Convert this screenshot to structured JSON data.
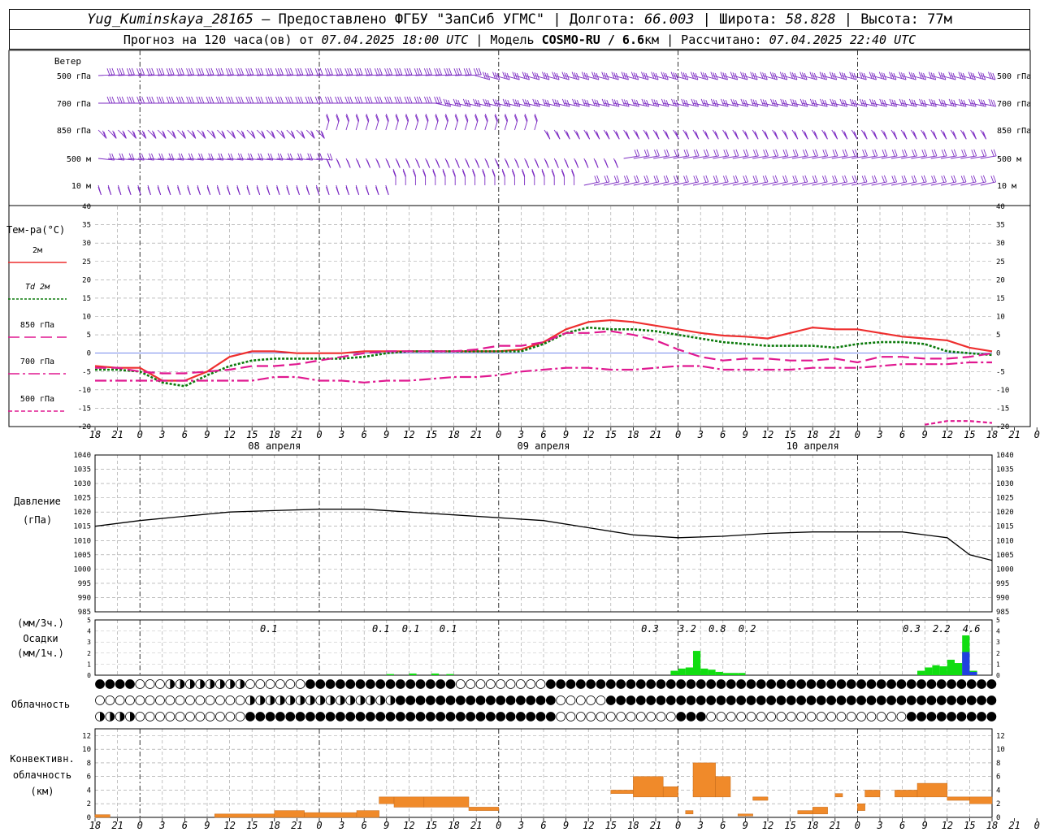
{
  "header": {
    "station": "Yug_Kuminskaya_28165",
    "dash": "—",
    "provider": "Предоставлено ФГБУ \"ЗапСиб УГМС\"",
    "lon_label": "Долгота:",
    "lon_value": "66.003",
    "lat_label": "Широта:",
    "lat_value": "58.828",
    "alt_label": "Высота:",
    "alt_value": "77м",
    "forecast_prefix": "Прогноз на 120 часа(ов) от",
    "forecast_date": "07.04.2025 18:00 UTC",
    "model_prefix": "| Модель",
    "model_name": "COSMO-RU / 6.6",
    "model_unit": "км",
    "calc_prefix": "| Рассчитано:",
    "calc_date": "07.04.2025 22:40 UTC"
  },
  "colors": {
    "wind": "#7b2ac2",
    "t2m": "#ee2f2f",
    "td2m": "#0b7a0b",
    "t850": "#e01890",
    "t700": "#e01890",
    "t500": "#e01890",
    "precip_green": "#11dd11",
    "precip_blue": "#2040e0",
    "convective": "#f08a2a",
    "pressure": "#000000"
  },
  "wind_panel": {
    "title": "Ветер",
    "levels": [
      "500 гПа",
      "700 гПа",
      "850 гПа",
      "500 м",
      "10 м"
    ]
  },
  "temp_panel": {
    "title": "Тем-ра(°С)",
    "legend": [
      {
        "label": "2м",
        "style": "solid",
        "color_key": "t2m"
      },
      {
        "label": "Td  2м",
        "style": "dotted",
        "color_key": "td2m"
      },
      {
        "label": "850 гПа",
        "style": "longdash",
        "color_key": "t850"
      },
      {
        "label": "700 гПа",
        "style": "dashdot",
        "color_key": "t700"
      },
      {
        "label": "500 гПа",
        "style": "dashed",
        "color_key": "t500"
      }
    ],
    "yticks": [
      "40",
      "35",
      "30",
      "25",
      "20",
      "15",
      "10",
      "5",
      "0",
      "-5",
      "-10",
      "-15",
      "-20"
    ]
  },
  "x_axis": {
    "hour_labels": [
      "18",
      "21",
      "0",
      "3",
      "6",
      "9",
      "12",
      "15",
      "18",
      "21",
      "0",
      "3",
      "6",
      "9",
      "12",
      "15",
      "18",
      "21",
      "0",
      "3",
      "6",
      "9",
      "12",
      "15",
      "18",
      "21",
      "0",
      "3",
      "6",
      "9",
      "12",
      "15",
      "18",
      "21",
      "0",
      "3",
      "6",
      "9",
      "12",
      "15",
      "18",
      "21",
      "0"
    ],
    "date_labels": [
      "08 апреля",
      "09 апреля",
      "10 апреля"
    ]
  },
  "pressure_panel": {
    "title": "Давление",
    "unit": "(гПа)",
    "yticks": [
      "1040",
      "1035",
      "1030",
      "1025",
      "1020",
      "1015",
      "1010",
      "1005",
      "1000",
      "995",
      "990",
      "985"
    ]
  },
  "precip_panel": {
    "title1": "(мм/3ч.)",
    "title2": "Осадки",
    "title3": "(мм/1ч.)",
    "yticks": [
      "5",
      "4",
      "3",
      "2",
      "1",
      "0"
    ],
    "labels": [
      "0.1",
      "0.1",
      "0.1",
      "0.1",
      "0.3",
      "3.2",
      "0.8",
      "0.2",
      "0.3",
      "2.2",
      "4.6"
    ]
  },
  "cloud_panel": {
    "title": "Облачность"
  },
  "conv_panel": {
    "title1": "Конвективн.",
    "title2": "облачность",
    "title3": "(км)",
    "yticks": [
      "12",
      "10",
      "8",
      "6",
      "4",
      "2",
      "0"
    ]
  },
  "chart_data": [
    {
      "type": "line",
      "title": "Тем-ра(°С)",
      "x_hours": [
        0,
        3,
        6,
        9,
        12,
        15,
        18,
        21,
        24,
        27,
        30,
        33,
        36,
        39,
        42,
        45,
        48,
        51,
        54,
        57,
        60,
        63,
        66,
        69,
        72,
        75,
        78,
        81,
        84,
        87,
        90,
        93,
        96,
        99,
        102,
        105,
        108,
        111,
        114,
        117,
        120
      ],
      "ylim": [
        -20,
        40
      ],
      "series": [
        {
          "name": "2м",
          "values": [
            -3.5,
            -4,
            -4,
            -7.5,
            -7.5,
            -5,
            -1,
            0.5,
            0.5,
            0,
            0,
            0,
            0.5,
            0.5,
            0.5,
            0.5,
            0.5,
            0.5,
            0.5,
            1,
            3,
            6.5,
            8.5,
            9,
            8.5,
            7.5,
            6.5,
            5.5,
            4.8,
            4.5,
            4,
            5.5,
            7,
            6.5,
            6.5,
            5.5,
            4.5,
            4,
            3.5,
            1.5,
            0.5
          ]
        },
        {
          "name": "Td  2м",
          "values": [
            -4.5,
            -4.5,
            -5,
            -8,
            -9,
            -6,
            -3.5,
            -2,
            -1.5,
            -1.5,
            -1.5,
            -1.5,
            -1,
            0,
            0.5,
            0.5,
            0.5,
            0.5,
            0.5,
            0.5,
            2.5,
            5.5,
            7,
            6.5,
            6.5,
            6,
            5,
            4,
            3,
            2.5,
            2,
            2,
            2,
            1.5,
            2.5,
            3,
            3,
            2.5,
            0.5,
            0,
            -0.5
          ]
        },
        {
          "name": "850 гПа",
          "values": [
            -4,
            -4,
            -5,
            -5.5,
            -5.5,
            -5,
            -4.5,
            -3.5,
            -3.5,
            -3,
            -2,
            -1,
            0,
            0.5,
            0.5,
            0.5,
            0.5,
            1,
            2,
            2,
            3,
            5.5,
            5.5,
            6,
            5,
            3.5,
            1,
            -1,
            -2,
            -1.5,
            -1.5,
            -2,
            -2,
            -1.5,
            -2.5,
            -1,
            -1,
            -1.5,
            -1.5,
            -1,
            0
          ]
        },
        {
          "name": "700 гПа",
          "values": [
            -7.5,
            -7.5,
            -7.5,
            -7.5,
            -7.5,
            -7.5,
            -7.5,
            -7.5,
            -6.5,
            -6.5,
            -7.5,
            -7.5,
            -8,
            -7.5,
            -7.5,
            -7,
            -6.5,
            -6.5,
            -6,
            -5,
            -4.5,
            -4,
            -4,
            -4.5,
            -4.5,
            -4,
            -3.5,
            -3.5,
            -4.5,
            -4.5,
            -4.5,
            -4.5,
            -4,
            -4,
            -4,
            -3.5,
            -3,
            -3,
            -3,
            -2.5,
            -2.5
          ]
        },
        {
          "name": "500 гПа",
          "values": [
            null,
            null,
            null,
            null,
            null,
            null,
            null,
            null,
            null,
            null,
            null,
            null,
            null,
            null,
            null,
            null,
            null,
            null,
            null,
            null,
            null,
            null,
            null,
            null,
            null,
            null,
            null,
            null,
            null,
            null,
            null,
            null,
            null,
            null,
            null,
            null,
            null,
            -19.5,
            -18.5,
            -18.5,
            -19
          ]
        }
      ]
    },
    {
      "type": "line",
      "title": "Давление",
      "ylabel": "(гПа)",
      "x_hours": [
        0,
        6,
        12,
        18,
        24,
        30,
        36,
        42,
        48,
        54,
        60,
        66,
        72,
        78,
        84,
        90,
        96,
        102,
        108,
        114,
        117,
        120
      ],
      "ylim": [
        985,
        1040
      ],
      "series": [
        {
          "name": "",
          "values": [
            1015,
            1017,
            1018.5,
            1020,
            1020.5,
            1021,
            1021,
            1020,
            1019,
            1018,
            1017,
            1014.5,
            1012,
            1011,
            1011.5,
            1012.5,
            1013,
            1013,
            1013,
            1011,
            1005,
            1003
          ]
        }
      ]
    },
    {
      "type": "bar",
      "title": "Осадки",
      "ylabel": "(мм/1ч.)",
      "ylim": [
        0,
        5
      ],
      "labels_3h": [
        {
          "hour": 24,
          "value": 0.1
        },
        {
          "hour": 39,
          "value": 0.1
        },
        {
          "hour": 43,
          "value": 0.1
        },
        {
          "hour": 48,
          "value": 0.1
        },
        {
          "hour": 75,
          "value": 0.3
        },
        {
          "hour": 80,
          "value": 3.2
        },
        {
          "hour": 84,
          "value": 0.8
        },
        {
          "hour": 88,
          "value": 0.2
        },
        {
          "hour": 110,
          "value": 0.3
        },
        {
          "hour": 114,
          "value": 2.2
        },
        {
          "hour": 118,
          "value": 4.6
        }
      ],
      "bars": [
        {
          "hour": 40,
          "value": 0.1
        },
        {
          "hour": 43,
          "value": 0.15
        },
        {
          "hour": 46,
          "value": 0.15
        },
        {
          "hour": 48,
          "value": 0.1
        },
        {
          "hour": 78,
          "value": 0.4
        },
        {
          "hour": 79,
          "value": 0.6
        },
        {
          "hour": 80,
          "value": 0.7
        },
        {
          "hour": 81,
          "value": 2.2
        },
        {
          "hour": 82,
          "value": 0.6
        },
        {
          "hour": 83,
          "value": 0.5
        },
        {
          "hour": 84,
          "value": 0.3
        },
        {
          "hour": 85,
          "value": 0.2
        },
        {
          "hour": 86,
          "value": 0.2
        },
        {
          "hour": 87,
          "value": 0.2
        },
        {
          "hour": 111,
          "value": 0.4
        },
        {
          "hour": 112,
          "value": 0.7
        },
        {
          "hour": 113,
          "value": 0.9
        },
        {
          "hour": 114,
          "value": 0.8
        },
        {
          "hour": 115,
          "value": 1.4
        },
        {
          "hour": 116,
          "value": 1.1
        },
        {
          "hour": 117,
          "value": 3.6
        },
        {
          "hour": 118,
          "value": 0.4
        }
      ],
      "bars_blue": [
        {
          "hour": 117,
          "value": 2.1
        },
        {
          "hour": 118,
          "value": 0.3
        }
      ]
    },
    {
      "type": "bar",
      "title": "Конвективн. облачность",
      "ylabel": "(км)",
      "ylim": [
        0,
        13
      ],
      "segments": [
        {
          "h0": 0,
          "h1": 2,
          "base": 0,
          "top": 0.4
        },
        {
          "h0": 16,
          "h1": 24,
          "base": 0,
          "top": 0.5
        },
        {
          "h0": 24,
          "h1": 28,
          "base": 0,
          "top": 1
        },
        {
          "h0": 28,
          "h1": 35,
          "base": 0,
          "top": 0.7
        },
        {
          "h0": 35,
          "h1": 38,
          "base": 0,
          "top": 1
        },
        {
          "h0": 38,
          "h1": 40,
          "base": 2,
          "top": 3
        },
        {
          "h0": 40,
          "h1": 44,
          "base": 1.5,
          "top": 3
        },
        {
          "h0": 44,
          "h1": 50,
          "base": 1.5,
          "top": 3
        },
        {
          "h0": 50,
          "h1": 54,
          "base": 1,
          "top": 1.5
        },
        {
          "h0": 69,
          "h1": 72,
          "base": 3.5,
          "top": 4
        },
        {
          "h0": 72,
          "h1": 76,
          "base": 3,
          "top": 6
        },
        {
          "h0": 76,
          "h1": 78,
          "base": 3,
          "top": 4.5
        },
        {
          "h0": 79,
          "h1": 80,
          "base": 0.5,
          "top": 1
        },
        {
          "h0": 80,
          "h1": 83,
          "base": 3,
          "top": 8
        },
        {
          "h0": 83,
          "h1": 85,
          "base": 3,
          "top": 6
        },
        {
          "h0": 86,
          "h1": 88,
          "base": 0.2,
          "top": 0.5
        },
        {
          "h0": 88,
          "h1": 90,
          "base": 2.5,
          "top": 3
        },
        {
          "h0": 94,
          "h1": 96,
          "base": 0.5,
          "top": 1
        },
        {
          "h0": 96,
          "h1": 98,
          "base": 0.5,
          "top": 1.5
        },
        {
          "h0": 99,
          "h1": 100,
          "base": 3,
          "top": 3.5
        },
        {
          "h0": 102,
          "h1": 103,
          "base": 1,
          "top": 2
        },
        {
          "h0": 103,
          "h1": 105,
          "base": 3,
          "top": 4
        },
        {
          "h0": 107,
          "h1": 110,
          "base": 3,
          "top": 4
        },
        {
          "h0": 110,
          "h1": 114,
          "base": 3,
          "top": 5
        },
        {
          "h0": 114,
          "h1": 117,
          "base": 2.5,
          "top": 3
        },
        {
          "h0": 117,
          "h1": 120,
          "base": 2,
          "top": 3
        }
      ]
    }
  ]
}
